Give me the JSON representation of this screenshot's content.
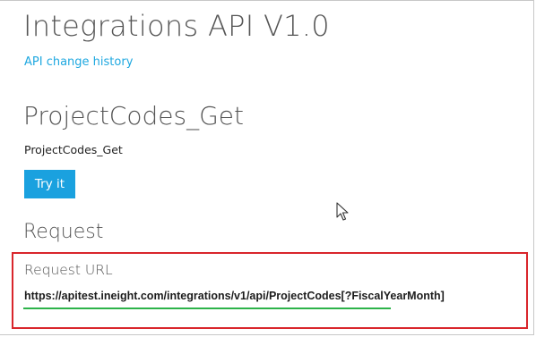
{
  "api": {
    "title": "Integrations API V1.0",
    "change_history_link": "API change history"
  },
  "operation": {
    "title": "ProjectCodes_Get",
    "description": "ProjectCodes_Get",
    "try_button_label": "Try it"
  },
  "request": {
    "heading": "Request",
    "url_label": "Request URL",
    "url": "https://apitest.ineight.com/integrations/v1/api/ProjectCodes[?FiscalYearMonth]"
  },
  "colors": {
    "link": "#1fa8e0",
    "button": "#1aa1df",
    "highlight_border": "#d9262c",
    "underline": "#2db34a"
  },
  "icons": {
    "cursor": "mouse-pointer-icon"
  }
}
